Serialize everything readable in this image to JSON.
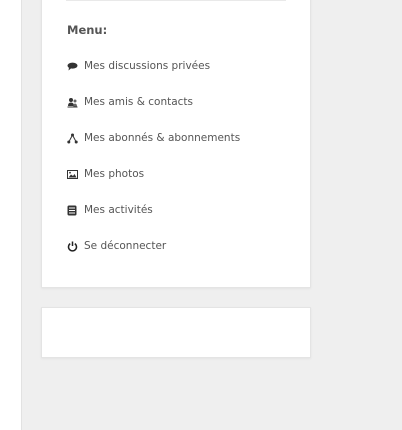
{
  "menu": {
    "title": "Menu:",
    "items": [
      {
        "label": "Mes discussions privées",
        "icon": "chat-icon"
      },
      {
        "label": "Mes amis & contacts",
        "icon": "friends-icon"
      },
      {
        "label": "Mes abonnés & abonnements",
        "icon": "network-icon"
      },
      {
        "label": "Mes photos",
        "icon": "photo-icon"
      },
      {
        "label": "Mes activités",
        "icon": "activity-icon"
      },
      {
        "label": "Se déconnecter",
        "icon": "power-icon"
      }
    ]
  },
  "colors": {
    "page_bg": "#efefef",
    "card_bg": "#ffffff",
    "text": "#555555"
  }
}
